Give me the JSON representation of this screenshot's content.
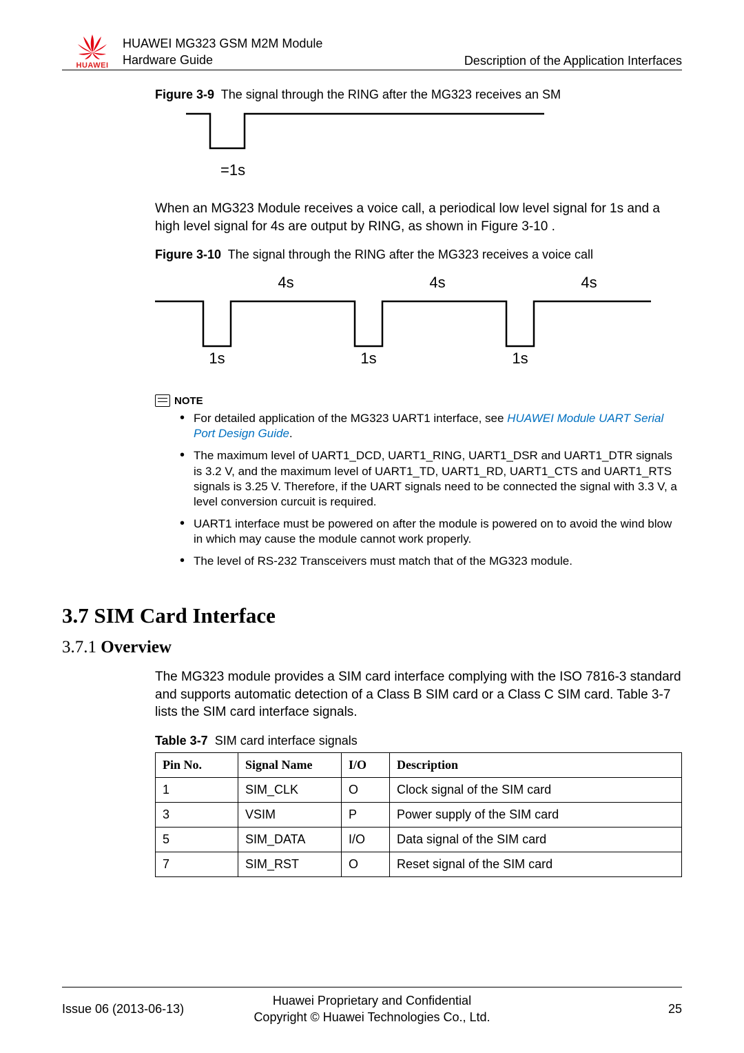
{
  "header": {
    "logo_name": "HUAWEI",
    "doc_title": "HUAWEI MG323 GSM M2M Module",
    "doc_subtitle": "Hardware Guide",
    "section_name": "Description of the Application Interfaces"
  },
  "figure39": {
    "label": "Figure 3-9",
    "caption": "The signal through the RING after the MG323 receives an SM",
    "annotation": "=1s"
  },
  "paragraph1": "When an MG323 Module receives a voice call, a periodical low level signal for 1s and a high level signal for 4s are output by RING, as shown in Figure 3-10 .",
  "figure310": {
    "label": "Figure 3-10",
    "caption": "The signal through the RING after the MG323 receives a voice call",
    "high_labels": [
      "4s",
      "4s",
      "4s"
    ],
    "low_labels": [
      "1s",
      "1s",
      "1s"
    ]
  },
  "note": {
    "heading": "NOTE",
    "items": [
      {
        "pre": "For detailed application of the MG323 UART1 interface, see ",
        "link": "HUAWEI Module UART Serial Port Design Guide",
        "post": "."
      },
      {
        "text": "The maximum level of UART1_DCD, UART1_RING, UART1_DSR and UART1_DTR signals is 3.2 V, and the maximum level of UART1_TD, UART1_RD, UART1_CTS and UART1_RTS signals is 3.25 V. Therefore, if the UART signals need to be connected the signal with 3.3 V, a level conversion curcuit is required."
      },
      {
        "text": "UART1 interface must be powered on after the module is powered on to avoid the wind blow in which may cause the module cannot work properly."
      },
      {
        "text": "The level of RS-232 Transceivers must match that of the MG323 module."
      }
    ]
  },
  "section": {
    "number": "3.7",
    "title": "SIM Card Interface"
  },
  "subsection": {
    "number": "3.7.1",
    "title": "Overview"
  },
  "overview_text": "The MG323 module provides a SIM card interface complying with the ISO 7816-3 standard and supports automatic detection of a Class B SIM card or a Class C SIM card. Table 3-7 lists the SIM card interface signals.",
  "table": {
    "label": "Table 3-7",
    "caption": "SIM card interface signals",
    "headers": [
      "Pin No.",
      "Signal Name",
      "I/O",
      "Description"
    ],
    "rows": [
      {
        "pin": "1",
        "signal": "SIM_CLK",
        "io": "O",
        "desc": "Clock signal of the SIM card"
      },
      {
        "pin": "3",
        "signal": "VSIM",
        "io": "P",
        "desc": "Power supply of the SIM card"
      },
      {
        "pin": "5",
        "signal": "SIM_DATA",
        "io": "I/O",
        "desc": "Data signal of the SIM card"
      },
      {
        "pin": "7",
        "signal": "SIM_RST",
        "io": "O",
        "desc": "Reset signal of the SIM card"
      }
    ]
  },
  "footer": {
    "issue": "Issue 06 (2013-06-13)",
    "center1": "Huawei Proprietary and Confidential",
    "center2": "Copyright © Huawei Technologies Co., Ltd.",
    "page": "25"
  },
  "chart_data": [
    {
      "type": "line",
      "title": "RING signal after receiving an SM",
      "description": "Single low pulse of duration 1s on RING line",
      "levels": [
        "high",
        "low (1s)",
        "high"
      ],
      "low_pulse_duration_s": 1
    },
    {
      "type": "line",
      "title": "RING signal after receiving a voice call",
      "description": "Periodic waveform: 1s low, 4s high, repeating",
      "period_s": 5,
      "low_duration_s": 1,
      "high_duration_s": 4,
      "sequence": [
        "high",
        "low 1s",
        "high 4s",
        "low 1s",
        "high 4s",
        "low 1s",
        "high 4s"
      ]
    }
  ]
}
